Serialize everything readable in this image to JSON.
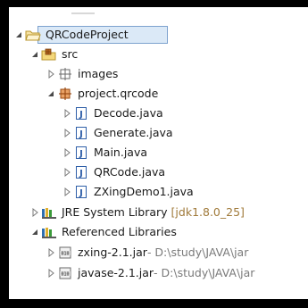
{
  "tree": {
    "project": {
      "label": "QRCodeProject"
    },
    "src": {
      "label": "src"
    },
    "images": {
      "label": "images"
    },
    "package": {
      "label": "project.qrcode"
    },
    "files": [
      {
        "label": "Decode.java"
      },
      {
        "label": "Generate.java"
      },
      {
        "label": "Main.java"
      },
      {
        "label": "QRCode.java"
      },
      {
        "label": "ZXingDemo1.java"
      }
    ],
    "jre": {
      "label": "JRE System Library",
      "version": "[jdk1.8.0_25]"
    },
    "referenced": {
      "label": "Referenced Libraries"
    },
    "jars": [
      {
        "label": "zxing-2.1.jar",
        "path": " - D:\\study\\JAVA\\jar"
      },
      {
        "label": "javase-2.1.jar",
        "path": " - D:\\study\\JAVA\\jar"
      }
    ]
  },
  "colors": {
    "selection": "#dbe9f7",
    "selection_border": "#7da2ce",
    "arrow": "#6a6a6a",
    "java_icon": "#2f5fa8",
    "package_icon": "#b5651d",
    "library_icon": "#2f6fb0"
  },
  "icons": {
    "project": "project-folder-icon",
    "src": "source-folder-icon",
    "images": "empty-package-icon",
    "package": "package-icon",
    "java": "java-file-icon",
    "library": "library-icon",
    "jar": "jar-file-icon"
  }
}
